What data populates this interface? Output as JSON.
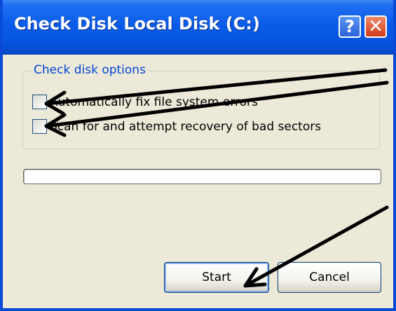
{
  "window": {
    "title": "Check Disk Local Disk (C:)",
    "help_glyph": "?",
    "close_glyph": "✕"
  },
  "options_group": {
    "legend": "Check disk options",
    "options": [
      {
        "label": "Automatically fix file system errors",
        "checked": false
      },
      {
        "label": "Scan for and attempt recovery of bad sectors",
        "checked": false
      }
    ]
  },
  "progress": {
    "value": 0
  },
  "buttons": {
    "start": "Start",
    "cancel": "Cancel"
  },
  "annotations": {
    "arrow_color": "#000000",
    "count": 3
  },
  "colors": {
    "titlebar": "#0a5ce8",
    "legend_text": "#0046d5",
    "dialog_bg": "#ece9d8"
  }
}
